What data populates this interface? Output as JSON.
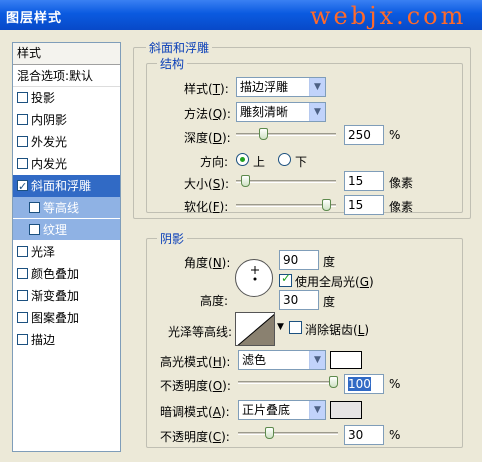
{
  "window": {
    "title": "图层样式",
    "watermark": "webjx.com"
  },
  "sidebar": {
    "header": "样式",
    "blend": "混合选项:默认",
    "items": [
      {
        "label": "投影",
        "checked": false
      },
      {
        "label": "内阴影",
        "checked": false
      },
      {
        "label": "外发光",
        "checked": false
      },
      {
        "label": "内发光",
        "checked": false
      },
      {
        "label": "斜面和浮雕",
        "checked": true,
        "selected": true
      },
      {
        "label": "等高线",
        "checked": false,
        "sub": true
      },
      {
        "label": "纹理",
        "checked": false,
        "sub": true
      },
      {
        "label": "光泽",
        "checked": false
      },
      {
        "label": "颜色叠加",
        "checked": false
      },
      {
        "label": "渐变叠加",
        "checked": false
      },
      {
        "label": "图案叠加",
        "checked": false
      },
      {
        "label": "描边",
        "checked": false
      }
    ]
  },
  "bevel": {
    "section": "斜面和浮雕",
    "structure": "结构",
    "style_label": "样式(",
    "style_key": "T",
    "style_close": "):",
    "style_value": "描边浮雕",
    "technique_label": "方法(",
    "technique_key": "Q",
    "technique_close": "):",
    "technique_value": "雕刻清晰",
    "depth_label": "深度(",
    "depth_key": "D",
    "depth_close": "):",
    "depth_value": "250",
    "depth_unit": "%",
    "depth_level": 0.25,
    "direction_label": "方向:",
    "dir_up": "上",
    "dir_down": "下",
    "size_label": "大小(",
    "size_key": "S",
    "size_close": "):",
    "size_value": "15",
    "size_unit": "像素",
    "size_level": 0.06,
    "soften_label": "软化(",
    "soften_key": "F",
    "soften_close": "):",
    "soften_value": "15",
    "soften_unit": "像素",
    "soften_level": 0.95
  },
  "shading": {
    "section": "阴影",
    "angle_label": "角度(",
    "angle_key": "N",
    "angle_close": "):",
    "angle_value": "90",
    "angle_unit": "度",
    "global_light": "使用全局光(",
    "global_key": "G",
    "global_close": ")",
    "altitude_label": "高度:",
    "altitude_value": "30",
    "altitude_unit": "度",
    "gloss_label": "光泽等高线:",
    "antialias": "消除锯齿(",
    "antialias_key": "L",
    "antialias_close": ")",
    "hl_mode_label": "高光模式(",
    "hl_mode_key": "H",
    "hl_mode_close": "):",
    "hl_mode_value": "滤色",
    "hl_opacity_label": "不透明度(",
    "hl_opacity_key": "O",
    "hl_opacity_close": "):",
    "hl_opacity_value": "100",
    "hl_opacity_unit": "%",
    "hl_opacity_level": 1.0,
    "sh_mode_label": "暗调模式(",
    "sh_mode_key": "A",
    "sh_mode_close": "):",
    "sh_mode_value": "正片叠底",
    "sh_opacity_label": "不透明度(",
    "sh_opacity_key": "C",
    "sh_opacity_close": "):",
    "sh_opacity_value": "30",
    "sh_opacity_unit": "%",
    "sh_opacity_level": 0.3
  },
  "colors": {
    "highlight": "#ffffff",
    "shadow": "#e6e4e4",
    "selection": "#316ac5"
  }
}
